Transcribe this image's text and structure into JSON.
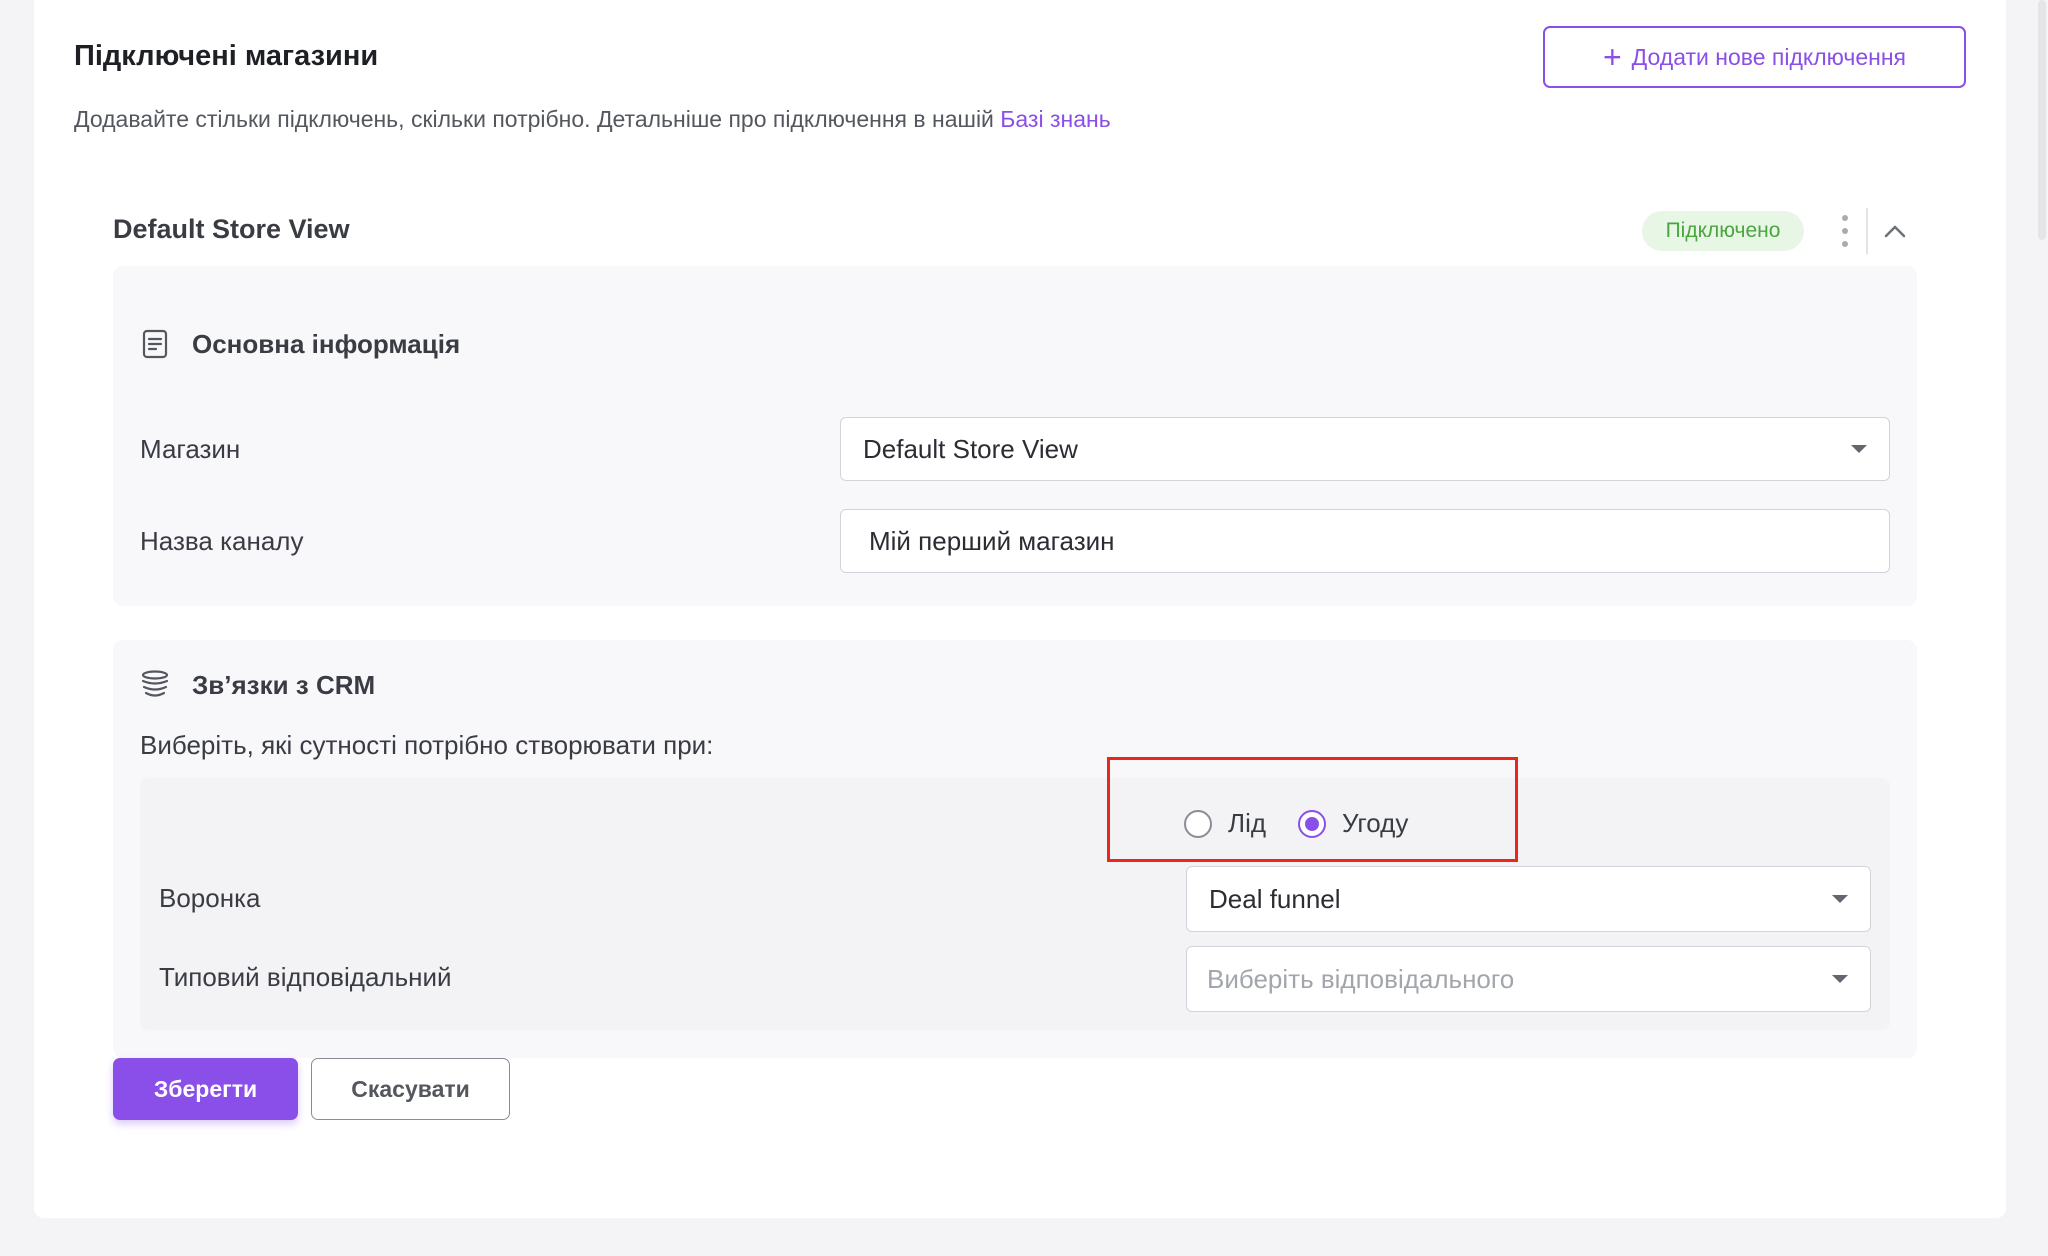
{
  "header": {
    "title": "Підключені магазини",
    "subtitle": "Додавайте стільки підключень, скільки потрібно. Детальніше про підключення в нашій ",
    "kb_link": "Базі знань",
    "add_button": "Додати нове підключення",
    "add_icon": "plus-icon"
  },
  "store": {
    "title": "Default Store View",
    "status": "Підключено",
    "status_color": "#4aa63e",
    "menu_icon": "kebab-menu-icon",
    "collapse_icon": "chevron-up-icon"
  },
  "basic_info": {
    "title": "Основна інформація",
    "icon": "document-icon",
    "store_label": "Магазин",
    "store_value": "Default Store View",
    "channel_label": "Назва каналу",
    "channel_value": "Мій перший магазин"
  },
  "crm": {
    "title": "Зв’язки з CRM",
    "icon": "database-icon",
    "prompt": "Виберіть, які сутності потрібно створювати при:",
    "options": [
      {
        "label": "Лід",
        "selected": false
      },
      {
        "label": "Угоду",
        "selected": true
      }
    ],
    "funnel_label": "Воронка",
    "funnel_value": "Deal funnel",
    "responsible_label": "Типовий відповідальний",
    "responsible_placeholder": "Виберіть відповідального"
  },
  "actions": {
    "save": "Зберегти",
    "cancel": "Скасувати"
  },
  "colors": {
    "accent": "#8a4fe8",
    "highlight": "#e8281c"
  }
}
